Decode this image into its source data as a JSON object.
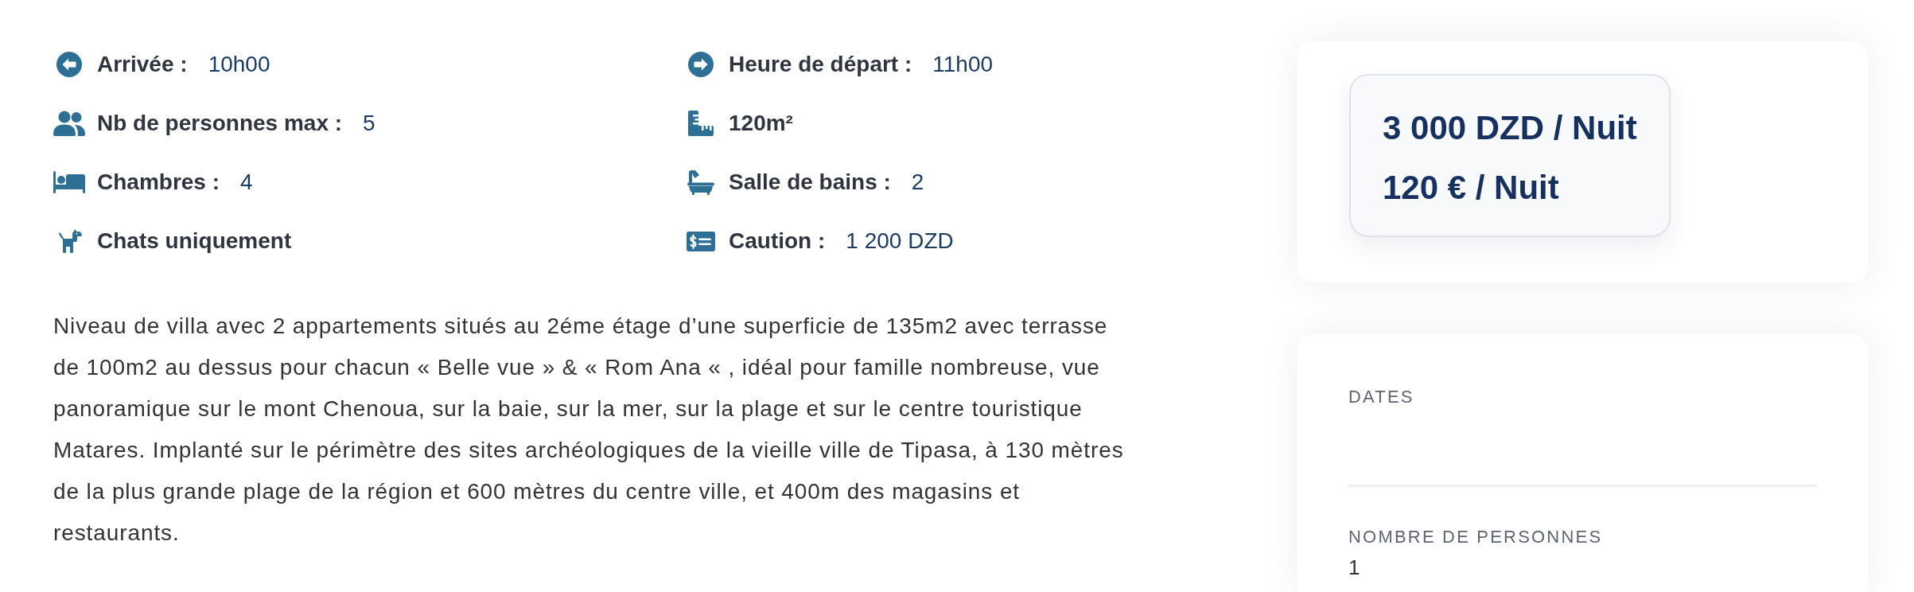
{
  "features": [
    {
      "kind": "checkin",
      "label": "Arrivée :",
      "value": "10h00"
    },
    {
      "kind": "checkout",
      "label": "Heure de départ :",
      "value": "11h00"
    },
    {
      "kind": "capacity",
      "label": "Nb de personnes max :",
      "value": "5"
    },
    {
      "kind": "surface",
      "label": "120m²"
    },
    {
      "kind": "bedrooms",
      "label": "Chambres :",
      "value": "4"
    },
    {
      "kind": "bathrooms",
      "label": "Salle de bains :",
      "value": "2"
    },
    {
      "kind": "pets",
      "label": "Chats uniquement"
    },
    {
      "kind": "deposit",
      "label": "Caution :",
      "value": "1 200 DZD"
    }
  ],
  "description": "Niveau de villa avec 2 appartements situés au 2éme étage d’une superficie de 135m2 avec terrasse de 100m2 au dessus pour chacun « Belle vue » & « Rom Ana « , idéal pour famille nombreuse, vue panoramique sur le mont Chenoua, sur la baie, sur la mer, sur la plage et sur le centre touristique Matares. Implanté sur le périmètre des sites archéologiques de la vieille ville de Tipasa, à 130 mètres de la plus grande plage de la région et 600 mètres du centre ville, et 400m des magasins et restaurants.",
  "price_card": {
    "prices": [
      "3 000 DZD / Nuit",
      "120 € / Nuit"
    ]
  },
  "booking_form": {
    "fields": [
      {
        "kind": "date",
        "label": "DATES"
      },
      {
        "kind": "number",
        "label": "NOMBRE DE PERSONNES",
        "value": "1"
      }
    ]
  }
}
